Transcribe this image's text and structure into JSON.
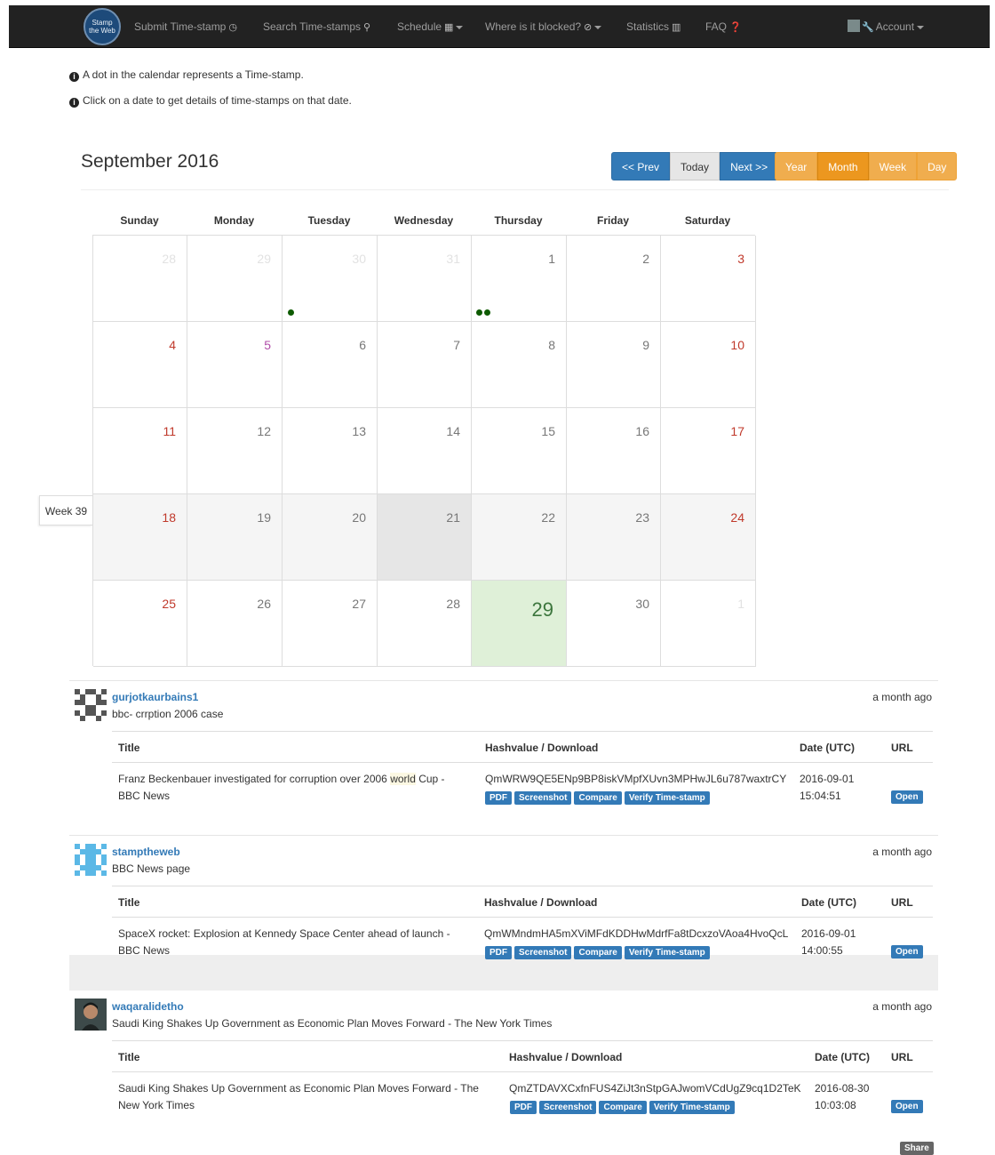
{
  "nav": {
    "logo_line1": "Stamp",
    "logo_line2": "the Web",
    "submit": "Submit Time-stamp",
    "search": "Search Time-stamps",
    "schedule": "Schedule",
    "blocked": "Where is it blocked?",
    "statistics": "Statistics",
    "faq": "FAQ",
    "account": "Account"
  },
  "hints": [
    "A dot in the calendar represents a Time-stamp.",
    "Click on a date to get details of time-stamps on that date."
  ],
  "calendar": {
    "title": "September 2016",
    "prev": "<< Prev",
    "today": "Today",
    "next": "Next >>",
    "views": [
      "Year",
      "Month",
      "Week",
      "Day"
    ],
    "active_view": "Month",
    "weekdays": [
      "Sunday",
      "Monday",
      "Tuesday",
      "Wednesday",
      "Thursday",
      "Friday",
      "Saturday"
    ],
    "week_label": "Week 39",
    "weeks": [
      [
        "28",
        "29",
        "30",
        "31",
        "1",
        "2",
        "3"
      ],
      [
        "4",
        "5",
        "6",
        "7",
        "8",
        "9",
        "10"
      ],
      [
        "11",
        "12",
        "13",
        "14",
        "15",
        "16",
        "17"
      ],
      [
        "18",
        "19",
        "20",
        "21",
        "22",
        "23",
        "24"
      ],
      [
        "25",
        "26",
        "27",
        "28",
        "29",
        "30",
        "1"
      ]
    ]
  },
  "table_headers": {
    "title": "Title",
    "hash": "Hashvalue / Download",
    "date": "Date (UTC)",
    "url": "URL"
  },
  "actions": {
    "pdf": "PDF",
    "screenshot": "Screenshot",
    "compare": "Compare",
    "verify": "Verify Time-stamp",
    "open": "Open",
    "share": "Share"
  },
  "entries": [
    {
      "user": "gurjotkaurbains1",
      "desc": "bbc- crrption 2006 case",
      "time": "a month ago",
      "title_pre": "Franz Beckenbauer investigated for corruption over 2006 ",
      "title_hl": "world",
      "title_post": " Cup - BBC News",
      "hash": "QmWRW9QE5ENp9BP8iskVMpfXUvn3MPHwJL6u787waxtrCY",
      "date": "2016-09-01",
      "clock": "15:04:51"
    },
    {
      "user": "stamptheweb",
      "desc": "BBC News page",
      "time": "a month ago",
      "title": "SpaceX rocket: Explosion at Kennedy Space Center ahead of launch - BBC News",
      "hash": "QmWMndmHA5mXViMFdKDDHwMdrfFa8tDcxzoVAoa4HvoQcL",
      "date": "2016-09-01",
      "clock": "14:00:55"
    },
    {
      "user": "waqaralidetho",
      "desc": "Saudi King Shakes Up Government as Economic Plan Moves Forward - The New York Times",
      "time": "a month ago",
      "title": "Saudi King Shakes Up Government as Economic Plan Moves Forward - The New York Times",
      "hash": "QmZTDAVXCxfnFUS4ZiJt3nStpGAJwomVCdUgZ9cq1D2TeK",
      "date": "2016-08-30",
      "clock": "10:03:08"
    }
  ]
}
